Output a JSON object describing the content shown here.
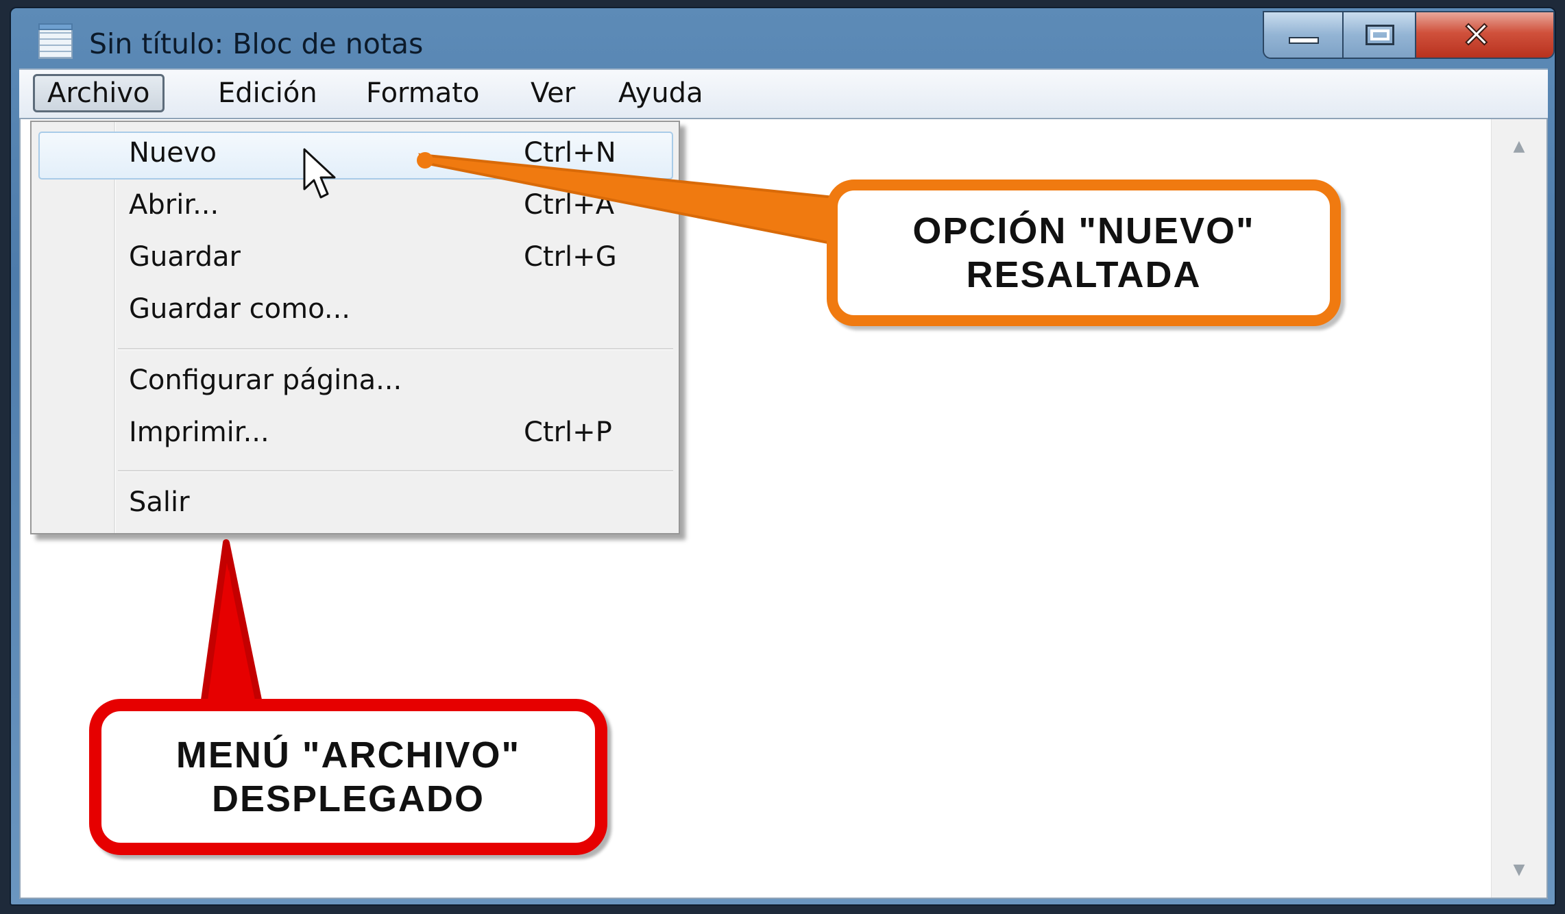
{
  "window": {
    "title": "Sin título: Bloc de notas"
  },
  "menubar": {
    "items": [
      {
        "label": "Archivo",
        "active": true
      },
      {
        "label": "Edición"
      },
      {
        "label": "Formato"
      },
      {
        "label": "Ver"
      },
      {
        "label": "Ayuda"
      }
    ]
  },
  "file_menu": {
    "items": [
      {
        "label": "Nuevo",
        "shortcut": "Ctrl+N",
        "highlighted": true
      },
      {
        "label": "Abrir...",
        "shortcut": "Ctrl+A"
      },
      {
        "label": "Guardar",
        "shortcut": "Ctrl+G"
      },
      {
        "label": "Guardar como...",
        "shortcut": ""
      },
      {
        "label": "Configurar página...",
        "shortcut": ""
      },
      {
        "label": "Imprimir...",
        "shortcut": "Ctrl+P"
      },
      {
        "label": "Salir",
        "shortcut": ""
      }
    ]
  },
  "annotations": {
    "orange_callout": "OPCIÓN \"NUEVO\"\nRESALTADA",
    "red_callout": "MENÚ \"ARCHIVO\"\nDESPLEGADO",
    "orange_color": "#f07a10",
    "red_color": "#e60000"
  },
  "icons": {
    "app": "notepad-icon",
    "minimize": "minimize-icon",
    "maximize": "maximize-icon",
    "close": "close-icon",
    "cursor": "mouse-pointer-icon"
  }
}
